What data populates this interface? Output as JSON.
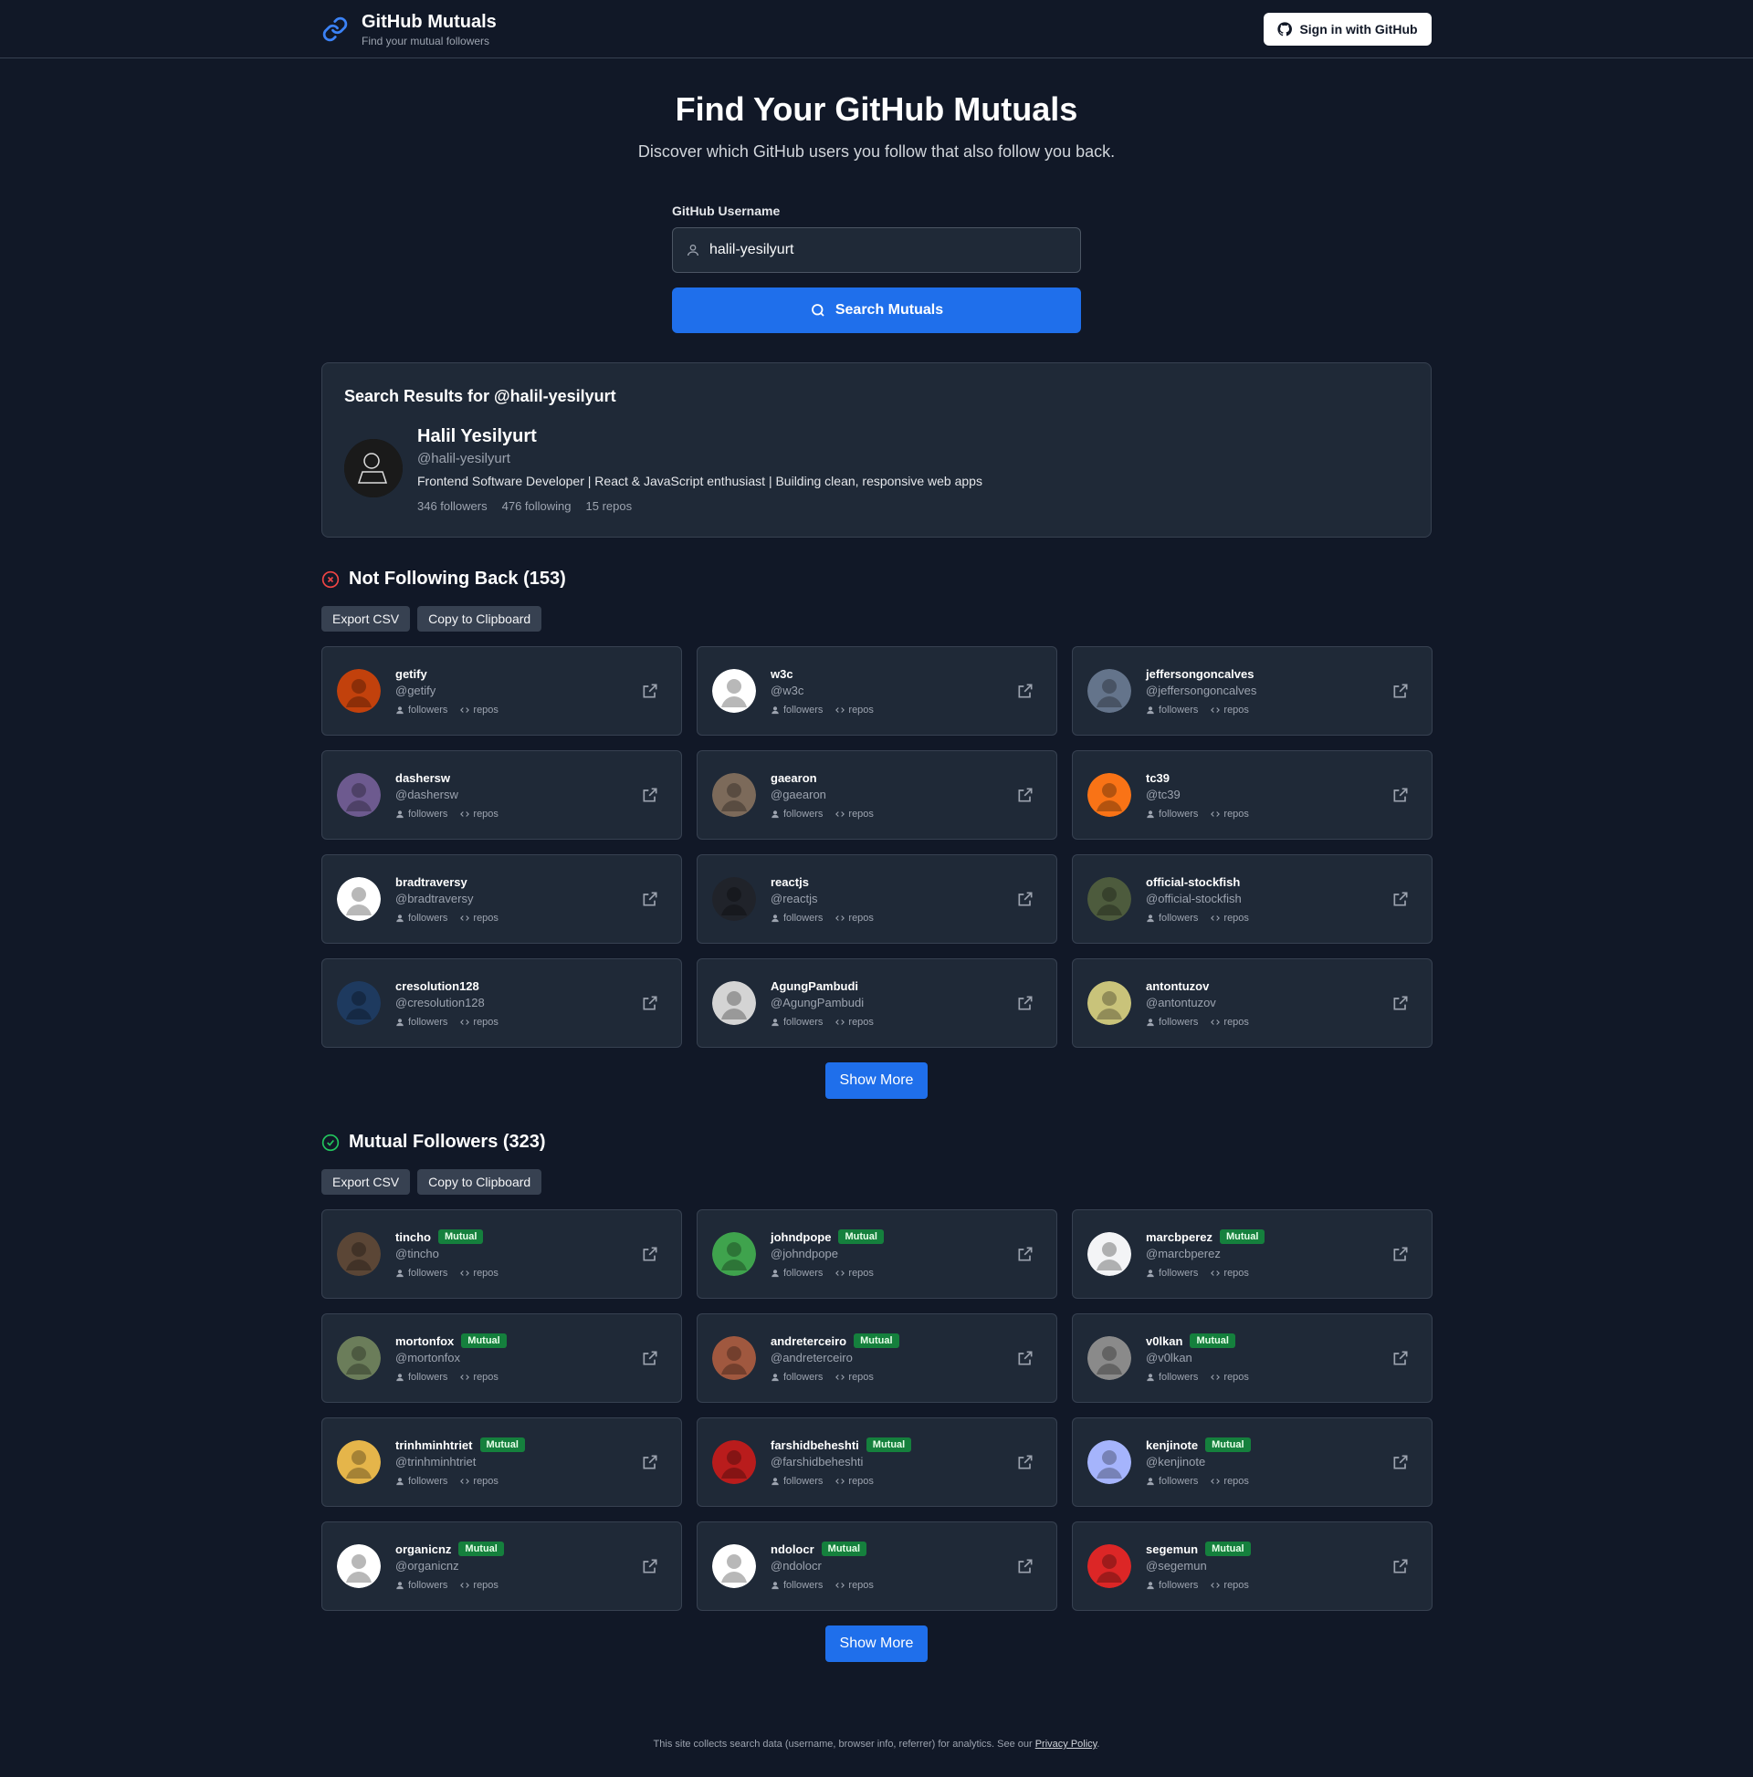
{
  "header": {
    "title": "GitHub Mutuals",
    "subtitle": "Find your mutual followers",
    "signin_label": "Sign in with GitHub",
    "icon": "link-icon"
  },
  "hero": {
    "title": "Find Your GitHub Mutuals",
    "subtitle": "Discover which GitHub users you follow that also follow you back."
  },
  "search": {
    "label": "GitHub Username",
    "value": "halil-yesilyurt",
    "button_label": "Search Mutuals"
  },
  "results": {
    "title": "Search Results for @halil-yesilyurt",
    "profile": {
      "name": "Halil Yesilyurt",
      "handle": "@halil-yesilyurt",
      "bio": "Frontend Software Developer | React & JavaScript enthusiast | Building clean, responsive web apps",
      "followers": "346 followers",
      "following": "476 following",
      "repos": "15 repos"
    }
  },
  "not_following": {
    "title": "Not Following Back (153)",
    "export_label": "Export CSV",
    "copy_label": "Copy to Clipboard",
    "show_more_label": "Show More",
    "users": [
      {
        "name": "getify",
        "handle": "@getify",
        "followers": "followers",
        "repos": "repos",
        "color": "#c2410c"
      },
      {
        "name": "w3c",
        "handle": "@w3c",
        "followers": "followers",
        "repos": "repos",
        "color": "#ffffff"
      },
      {
        "name": "jeffersongoncalves",
        "handle": "@jeffersongoncalves",
        "followers": "followers",
        "repos": "repos",
        "color": "#64748b"
      },
      {
        "name": "dashersw",
        "handle": "@dashersw",
        "followers": "followers",
        "repos": "repos",
        "color": "#6d5a8f"
      },
      {
        "name": "gaearon",
        "handle": "@gaearon",
        "followers": "followers",
        "repos": "repos",
        "color": "#7c6a5a"
      },
      {
        "name": "tc39",
        "handle": "@tc39",
        "followers": "followers",
        "repos": "repos",
        "color": "#f97316"
      },
      {
        "name": "bradtraversy",
        "handle": "@bradtraversy",
        "followers": "followers",
        "repos": "repos",
        "color": "#ffffff"
      },
      {
        "name": "reactjs",
        "handle": "@reactjs",
        "followers": "followers",
        "repos": "repos",
        "color": "#20232a"
      },
      {
        "name": "official-stockfish",
        "handle": "@official-stockfish",
        "followers": "followers",
        "repos": "repos",
        "color": "#4d5b3d"
      },
      {
        "name": "cresolution128",
        "handle": "@cresolution128",
        "followers": "followers",
        "repos": "repos",
        "color": "#1e3a5f"
      },
      {
        "name": "AgungPambudi",
        "handle": "@AgungPambudi",
        "followers": "followers",
        "repos": "repos",
        "color": "#d4d4d4"
      },
      {
        "name": "antontuzov",
        "handle": "@antontuzov",
        "followers": "followers",
        "repos": "repos",
        "color": "#c9c37a"
      }
    ]
  },
  "mutuals": {
    "title": "Mutual Followers (323)",
    "export_label": "Export CSV",
    "copy_label": "Copy to Clipboard",
    "badge_label": "Mutual",
    "show_more_label": "Show More",
    "users": [
      {
        "name": "tincho",
        "handle": "@tincho",
        "followers": "followers",
        "repos": "repos",
        "color": "#5b4636"
      },
      {
        "name": "johndpope",
        "handle": "@johndpope",
        "followers": "followers",
        "repos": "repos",
        "color": "#3fa34d"
      },
      {
        "name": "marcbperez",
        "handle": "@marcbperez",
        "followers": "followers",
        "repos": "repos",
        "color": "#f3f4f6"
      },
      {
        "name": "mortonfox",
        "handle": "@mortonfox",
        "followers": "followers",
        "repos": "repos",
        "color": "#6b7d5a"
      },
      {
        "name": "andreterceiro",
        "handle": "@andreterceiro",
        "followers": "followers",
        "repos": "repos",
        "color": "#a0583f"
      },
      {
        "name": "v0lkan",
        "handle": "@v0lkan",
        "followers": "followers",
        "repos": "repos",
        "color": "#8a8a8a"
      },
      {
        "name": "trinhminhtriet",
        "handle": "@trinhminhtriet",
        "followers": "followers",
        "repos": "repos",
        "color": "#e5b54a"
      },
      {
        "name": "farshidbeheshti",
        "handle": "@farshidbeheshti",
        "followers": "followers",
        "repos": "repos",
        "color": "#b91c1c"
      },
      {
        "name": "kenjinote",
        "handle": "@kenjinote",
        "followers": "followers",
        "repos": "repos",
        "color": "#a5b4fc"
      },
      {
        "name": "organicnz",
        "handle": "@organicnz",
        "followers": "followers",
        "repos": "repos",
        "color": "#ffffff"
      },
      {
        "name": "ndolocr",
        "handle": "@ndolocr",
        "followers": "followers",
        "repos": "repos",
        "color": "#ffffff"
      },
      {
        "name": "segemun",
        "handle": "@segemun",
        "followers": "followers",
        "repos": "repos",
        "color": "#dc2626"
      }
    ]
  },
  "footer": {
    "text": "This site collects search data (username, browser info, referrer) for analytics. See our ",
    "link": "Privacy Policy",
    "end": "."
  }
}
